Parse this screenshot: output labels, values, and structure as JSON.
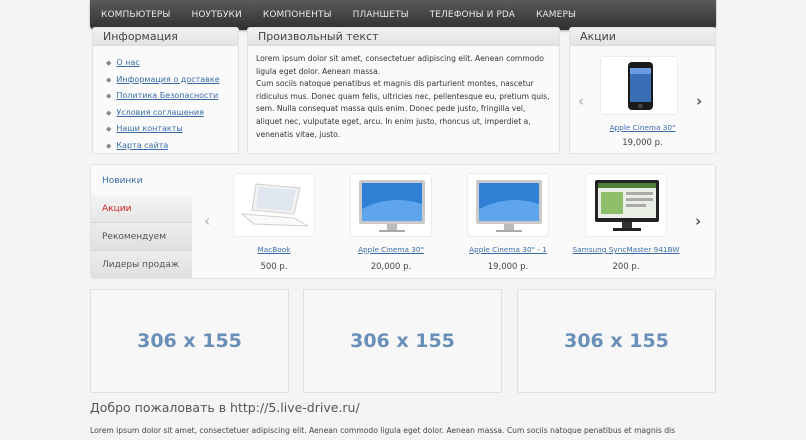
{
  "nav": {
    "items": [
      "КОМПЬЮТЕРЫ",
      "НОУТБУКИ",
      "КОМПОНЕНТЫ",
      "ПЛАНШЕТЫ",
      "ТЕЛЕФОНЫ И PDA",
      "КАМЕРЫ"
    ]
  },
  "info": {
    "title": "Информация",
    "links": [
      "О нас",
      "Информация о доставке",
      "Политика Безопасности",
      "Условия соглашения",
      "Наши контакты",
      "Карта сайта"
    ]
  },
  "free_text": {
    "title": "Произвольный текст",
    "body": "Lorem ipsum dolor sit amet, consectetuer adipiscing elit. Aenean commodo ligula eget dolor. Aenean massa.",
    "body2": "Cum sociis natoque penatibus et magnis dis parturient montes, nascetur ridiculus mus. Donec quam felis, ultricies nec, pellentesque eu, pretium quis, sem. Nulla consequat massa quis enim. Donec pede justo, fringilla vel, aliquet nec, vulputate eget, arcu. In enim justo, rhoncus ut, imperdiet a, venenatis vitae, justo."
  },
  "specials": {
    "title": "Акции",
    "product": {
      "name": "Apple Cinema 30\"",
      "price": "19,000 р.",
      "icon": "iphone-image"
    }
  },
  "tabs": [
    "Новинки",
    "Акции",
    "Рекомендуем",
    "Лидеры продаж"
  ],
  "carousel": [
    {
      "name": "MacBook",
      "price": "500 р.",
      "icon": "laptop-image"
    },
    {
      "name": "Apple Cinema 30\"",
      "price": "20,000 р.",
      "icon": "monitor-image"
    },
    {
      "name": "Apple Cinema 30\" - 1",
      "price": "19,000 р.",
      "icon": "monitor-image"
    },
    {
      "name": "Samsung SyncMaster 941BW",
      "price": "200 р.",
      "icon": "monitor-image"
    }
  ],
  "banners": [
    "306 x 155",
    "306 x 155",
    "306 x 155"
  ],
  "welcome": {
    "title": "Добро пожаловать в http://5.live-drive.ru/",
    "text": "Lorem ipsum dolor sit amet, consectetuer adipiscing elit. Aenean commodo ligula eget dolor. Aenean massa. Cum sociis natoque penatibus et magnis dis"
  },
  "colors": {
    "link": "#3a6da8",
    "active_tab": "#cc2222",
    "banner_text": "#6a8fb8"
  }
}
